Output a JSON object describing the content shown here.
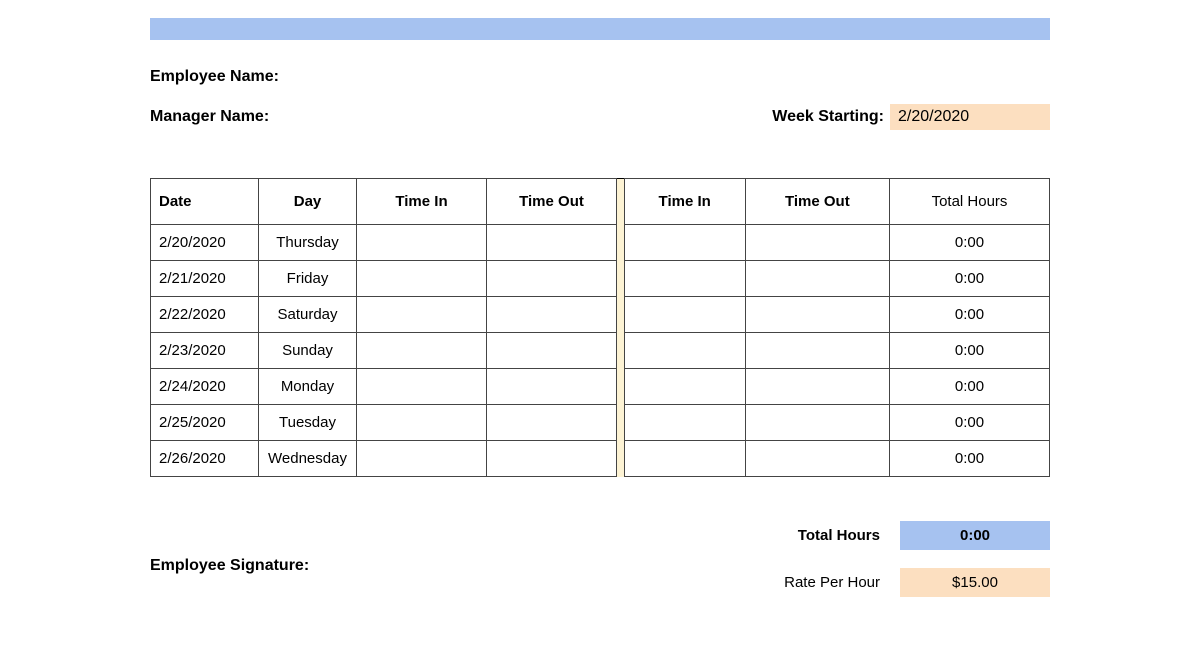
{
  "header": {
    "employee_label": "Employee Name:",
    "manager_label": "Manager Name:",
    "week_starting_label": "Week Starting:",
    "week_starting_value": "2/20/2020"
  },
  "table": {
    "columns": {
      "date": "Date",
      "day": "Day",
      "time_in_1": "Time In",
      "time_out_1": "Time Out",
      "time_in_2": "Time In",
      "time_out_2": "Time Out",
      "total": "Total Hours"
    },
    "rows": [
      {
        "date": "2/20/2020",
        "day": "Thursday",
        "in1": "",
        "out1": "",
        "in2": "",
        "out2": "",
        "total": "0:00"
      },
      {
        "date": "2/21/2020",
        "day": "Friday",
        "in1": "",
        "out1": "",
        "in2": "",
        "out2": "",
        "total": "0:00"
      },
      {
        "date": "2/22/2020",
        "day": "Saturday",
        "in1": "",
        "out1": "",
        "in2": "",
        "out2": "",
        "total": "0:00"
      },
      {
        "date": "2/23/2020",
        "day": "Sunday",
        "in1": "",
        "out1": "",
        "in2": "",
        "out2": "",
        "total": "0:00"
      },
      {
        "date": "2/24/2020",
        "day": "Monday",
        "in1": "",
        "out1": "",
        "in2": "",
        "out2": "",
        "total": "0:00"
      },
      {
        "date": "2/25/2020",
        "day": "Tuesday",
        "in1": "",
        "out1": "",
        "in2": "",
        "out2": "",
        "total": "0:00"
      },
      {
        "date": "2/26/2020",
        "day": "Wednesday",
        "in1": "",
        "out1": "",
        "in2": "",
        "out2": "",
        "total": "0:00"
      }
    ]
  },
  "summary": {
    "total_hours_label": "Total Hours",
    "total_hours_value": "0:00",
    "rate_label": "Rate Per Hour",
    "rate_value": "$15.00",
    "signature_label": "Employee Signature:"
  }
}
